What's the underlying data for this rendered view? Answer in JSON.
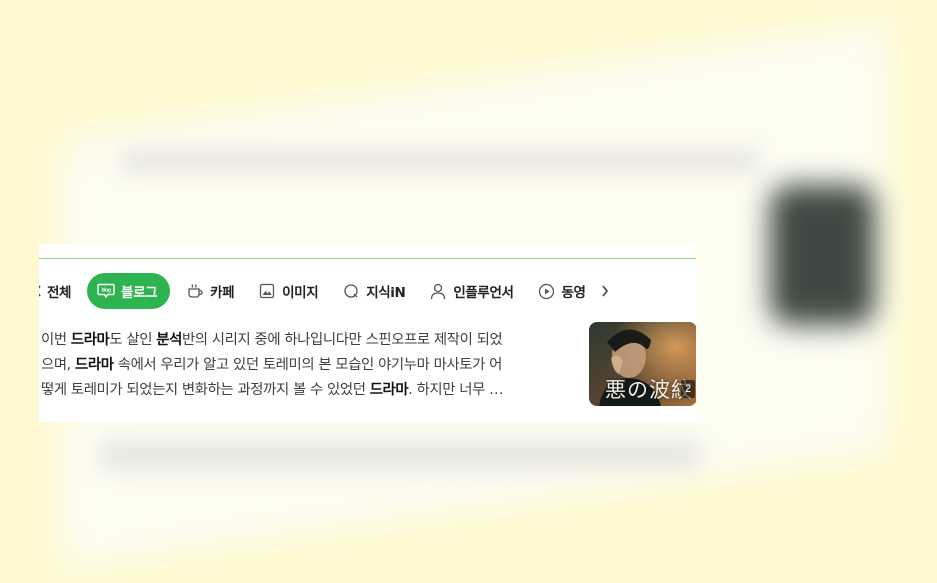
{
  "colors": {
    "background": "#fef8cf",
    "accent_green": "#2db34f",
    "bold_text": "#111111",
    "body_text": "#404040"
  },
  "tabs": [
    {
      "label": "전체",
      "icon": "chevron-left-icon",
      "active": false
    },
    {
      "label": "블로그",
      "icon": "blog-icon",
      "active": true
    },
    {
      "label": "카페",
      "icon": "cafe-cup-icon",
      "active": false
    },
    {
      "label": "이미지",
      "icon": "image-icon",
      "active": false
    },
    {
      "label": "지식iN",
      "icon": "knowledge-icon",
      "active": false
    },
    {
      "label": "인플루언서",
      "icon": "person-icon",
      "active": false
    },
    {
      "label": "동영",
      "icon": "play-icon",
      "active": false
    }
  ],
  "blog_badge": "blog",
  "more_tabs_icon": "chevron-right-icon",
  "snippet": {
    "line1": [
      {
        "t": "이번 ",
        "b": false
      },
      {
        "t": "드라마",
        "b": true
      },
      {
        "t": "도 살인 ",
        "b": false
      },
      {
        "t": "분석",
        "b": true
      },
      {
        "t": "반의 시리지 중에 하나입니다만 스핀오프로 제작이 되었",
        "b": false
      }
    ],
    "line2": [
      {
        "t": "으며, ",
        "b": false
      },
      {
        "t": "드라마",
        "b": true
      },
      {
        "t": " 속에서 우리가 알고 있던 토레미의 본 모습인 야기누마 마사토가 어",
        "b": false
      }
    ],
    "line3": [
      {
        "t": "떻게 토레미가 되었는지 변화하는 과정까지 볼 수 있었던 ",
        "b": false
      },
      {
        "t": "드라마",
        "b": true
      },
      {
        "t": ". 하지만 너무 …",
        "b": false
      }
    ]
  },
  "thumbnail": {
    "title": "悪の波紋",
    "page_count": "2"
  }
}
